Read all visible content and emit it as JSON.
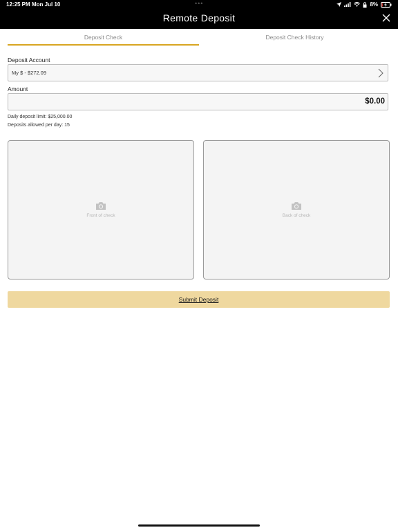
{
  "status_bar": {
    "time": "12:25 PM",
    "date": "Mon Jul 10",
    "battery": "8%"
  },
  "header": {
    "title": "Remote Deposit"
  },
  "tabs": [
    {
      "label": "Deposit Check",
      "active": true
    },
    {
      "label": "Deposit Check History",
      "active": false
    }
  ],
  "deposit_account": {
    "label": "Deposit Account",
    "value": "My $ - $272.09"
  },
  "amount": {
    "label": "Amount",
    "value": "$0.00"
  },
  "limits": {
    "daily": "Daily deposit limit: $25,000.00",
    "per_day": "Deposits allowed per day: 15"
  },
  "check_images": {
    "front_label": "Front of check",
    "back_label": "Back of check"
  },
  "submit_label": "Submit Deposit",
  "colors": {
    "accent": "#d8a520",
    "submit_bg": "#efd89f",
    "topbar": "#000000"
  }
}
